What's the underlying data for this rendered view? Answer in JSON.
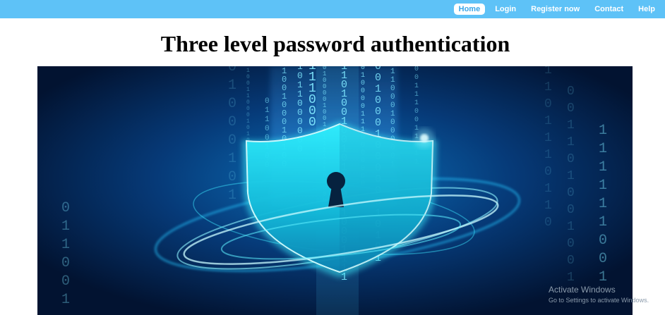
{
  "nav": {
    "items": [
      {
        "label": "Home",
        "active": true
      },
      {
        "label": "Login",
        "active": false
      },
      {
        "label": "Register now",
        "active": false
      },
      {
        "label": "Contact",
        "active": false
      },
      {
        "label": "Help",
        "active": false
      }
    ]
  },
  "page": {
    "title": "Three level password authentication"
  },
  "hero": {
    "icon": "shield-keyhole-icon",
    "binary_digits": [
      "0",
      "1"
    ]
  },
  "watermark": {
    "title": "Activate Windows",
    "subtitle": "Go to Settings to activate Windows."
  },
  "colors": {
    "navbar": "#5ec2f7",
    "hero_bg": "#031a3a",
    "shield": "#1fe0f0"
  }
}
